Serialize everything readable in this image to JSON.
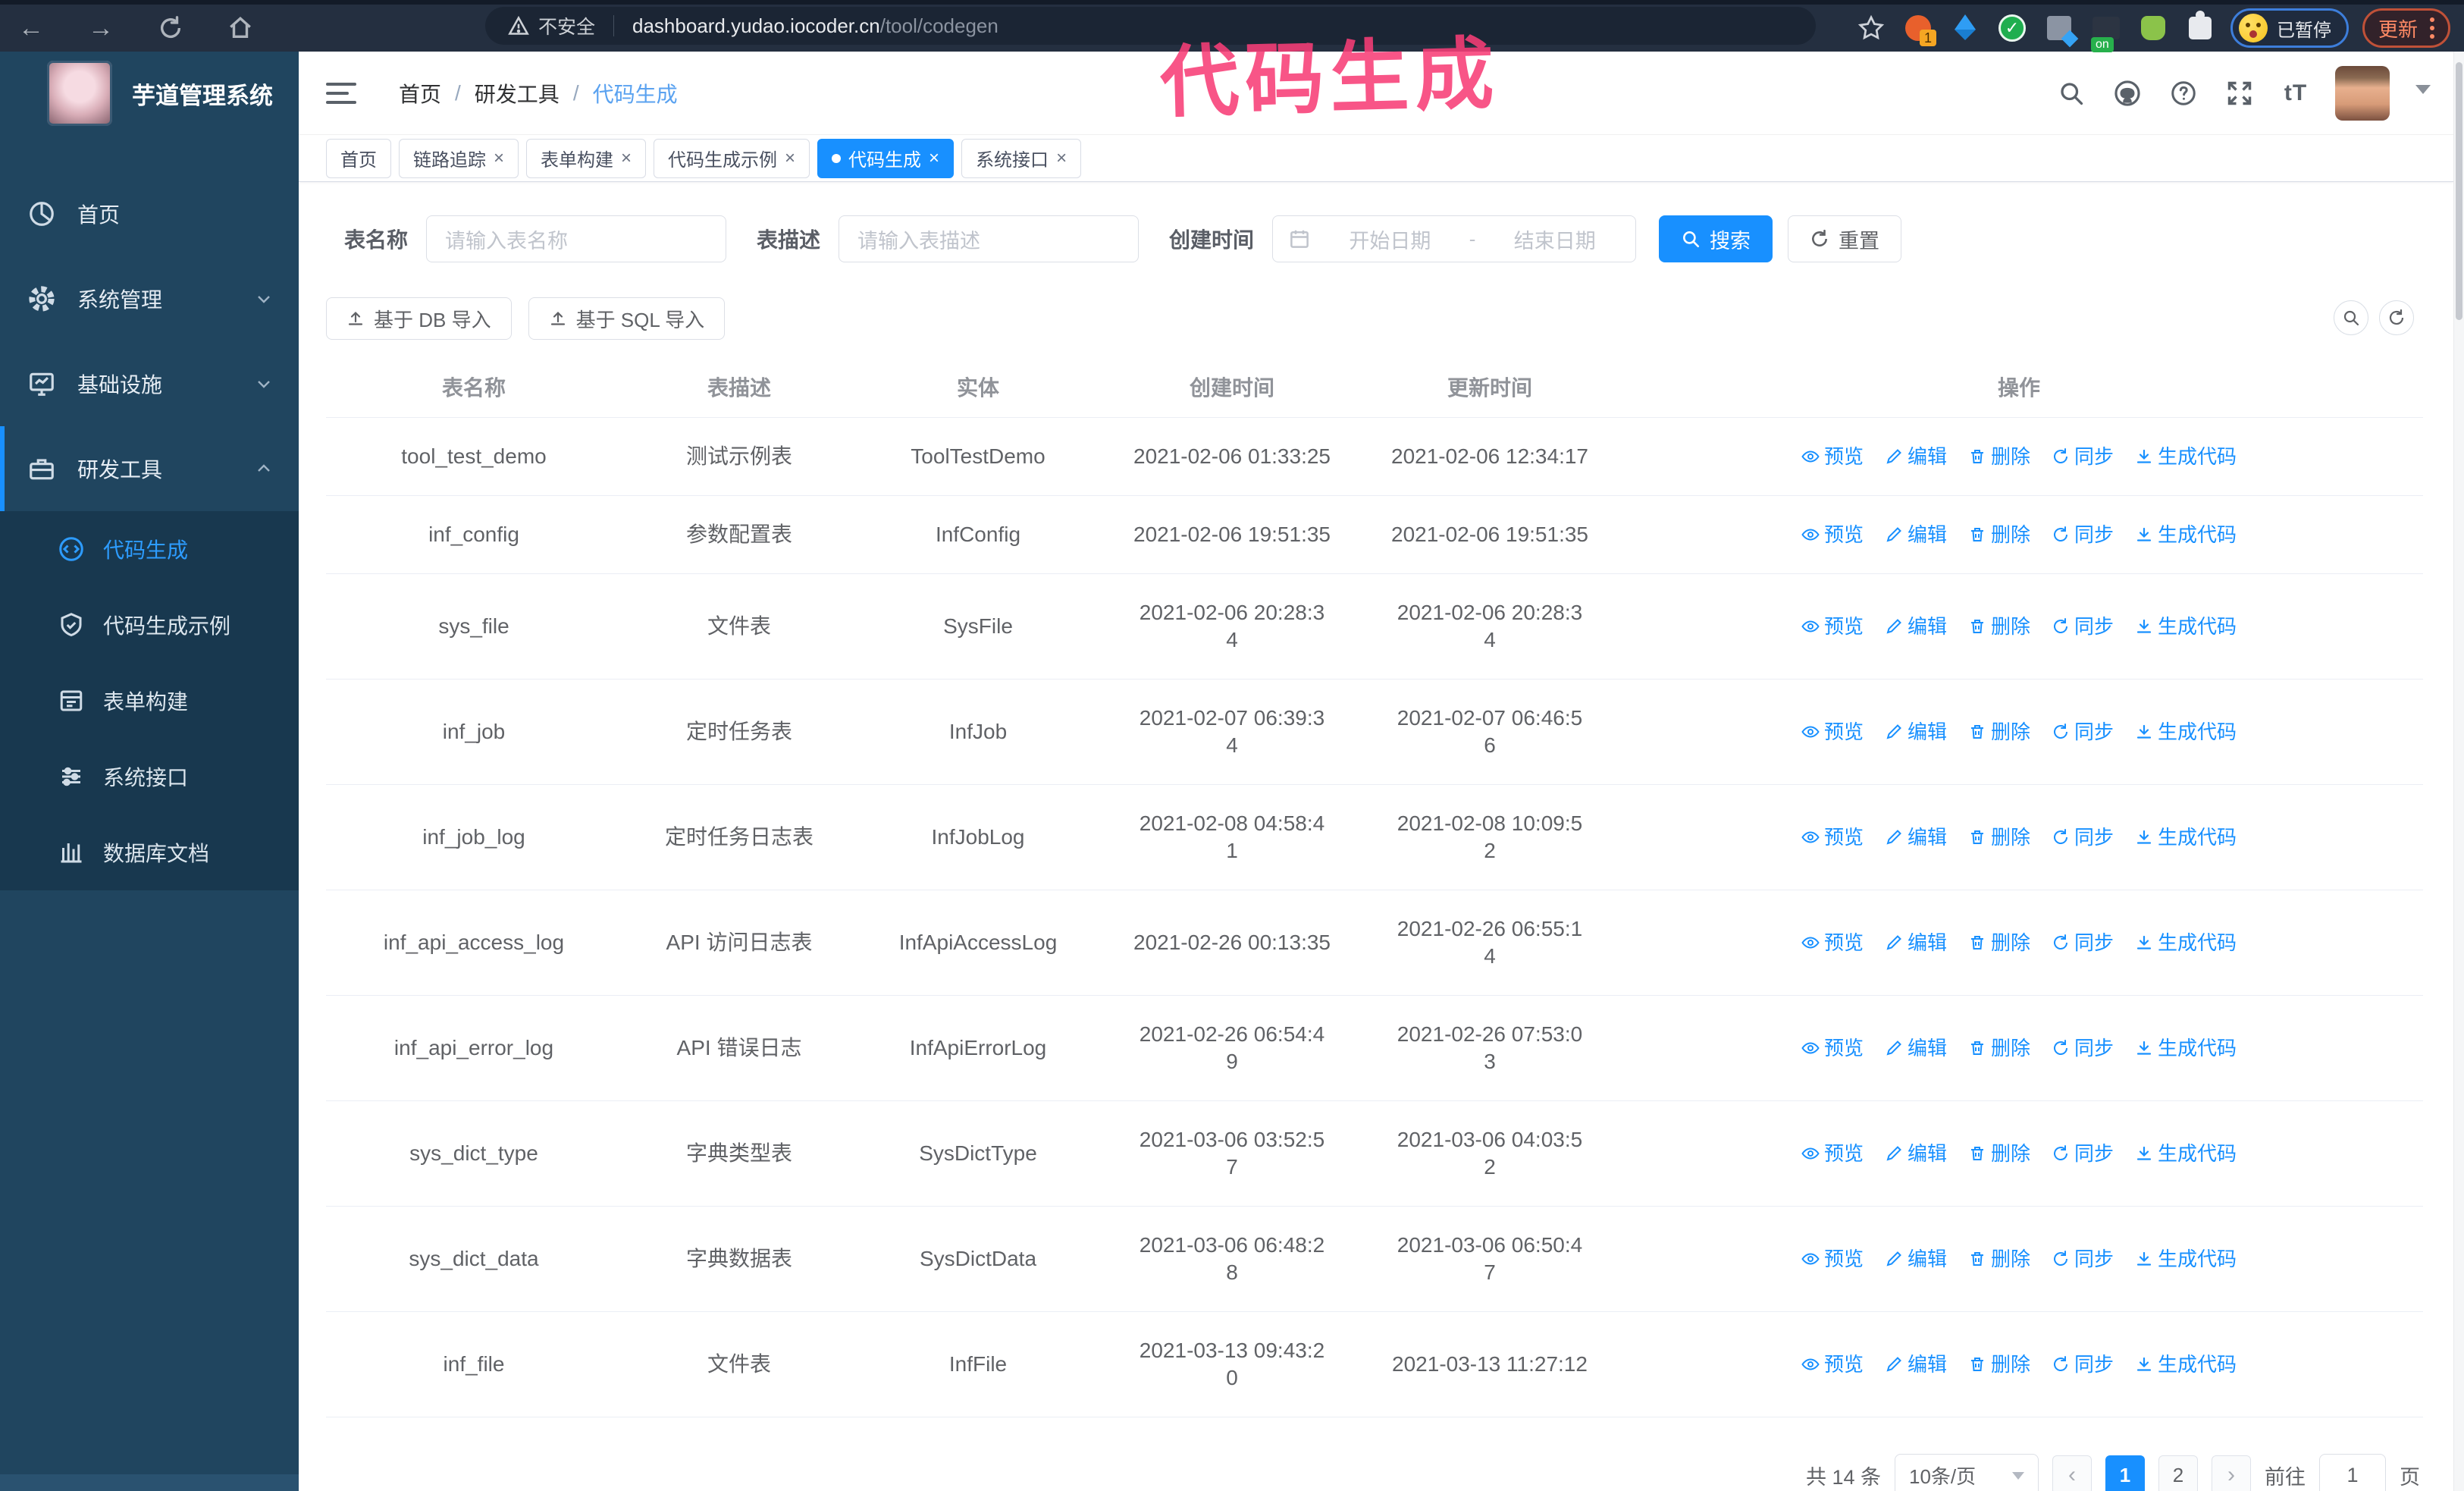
{
  "browser": {
    "security_warning": "不安全",
    "url_host": "dashboard.yudao.iocoder.cn",
    "url_path": "/tool/codegen",
    "extension_badge_count": "1",
    "extension_on_badge": "on",
    "paused_badge": "已暂停",
    "update_button": "更新"
  },
  "annotation": {
    "text": "代码生成",
    "color": "#f73e76"
  },
  "sidebar": {
    "title": "芋道管理系统",
    "items": [
      {
        "label": "首页"
      },
      {
        "label": "系统管理"
      },
      {
        "label": "基础设施"
      },
      {
        "label": "研发工具"
      }
    ],
    "submenu": [
      {
        "label": "代码生成",
        "active": true
      },
      {
        "label": "代码生成示例"
      },
      {
        "label": "表单构建"
      },
      {
        "label": "系统接口"
      },
      {
        "label": "数据库文档"
      }
    ]
  },
  "breadcrumb": {
    "items": [
      "首页",
      "研发工具",
      "代码生成"
    ],
    "separator": "/"
  },
  "tabs": [
    {
      "label": "首页"
    },
    {
      "label": "链路追踪",
      "closable": true
    },
    {
      "label": "表单构建",
      "closable": true
    },
    {
      "label": "代码生成示例",
      "closable": true
    },
    {
      "label": "代码生成",
      "closable": true,
      "active": true
    },
    {
      "label": "系统接口",
      "closable": true
    }
  ],
  "filters": {
    "name_label": "表名称",
    "name_placeholder": "请输入表名称",
    "desc_label": "表描述",
    "desc_placeholder": "请输入表描述",
    "time_label": "创建时间",
    "start_placeholder": "开始日期",
    "range_separator": "-",
    "end_placeholder": "结束日期",
    "search_label": "搜索",
    "reset_label": "重置"
  },
  "toolbar": {
    "import_db_label": "基于 DB 导入",
    "import_sql_label": "基于 SQL 导入"
  },
  "table": {
    "columns": [
      "表名称",
      "表描述",
      "实体",
      "创建时间",
      "更新时间",
      "操作"
    ],
    "actions": [
      "预览",
      "编辑",
      "删除",
      "同步",
      "生成代码"
    ],
    "rows": [
      {
        "name": "tool_test_demo",
        "desc": "测试示例表",
        "entity": "ToolTestDemo",
        "created": "2021-02-06 01:33:25",
        "updated": "2021-02-06 12:34:17"
      },
      {
        "name": "inf_config",
        "desc": "参数配置表",
        "entity": "InfConfig",
        "created": "2021-02-06 19:51:35",
        "updated": "2021-02-06 19:51:35"
      },
      {
        "name": "sys_file",
        "desc": "文件表",
        "entity": "SysFile",
        "created": "2021-02-06 20:28:34",
        "updated": "2021-02-06 20:28:34"
      },
      {
        "name": "inf_job",
        "desc": "定时任务表",
        "entity": "InfJob",
        "created": "2021-02-07 06:39:34",
        "updated": "2021-02-07 06:46:56"
      },
      {
        "name": "inf_job_log",
        "desc": "定时任务日志表",
        "entity": "InfJobLog",
        "created": "2021-02-08 04:58:41",
        "updated": "2021-02-08 10:09:52"
      },
      {
        "name": "inf_api_access_log",
        "desc": "API 访问日志表",
        "entity": "InfApiAccessLog",
        "created": "2021-02-26 00:13:35",
        "updated": "2021-02-26 06:55:14"
      },
      {
        "name": "inf_api_error_log",
        "desc": "API 错误日志",
        "entity": "InfApiErrorLog",
        "created": "2021-02-26 06:54:49",
        "updated": "2021-02-26 07:53:03"
      },
      {
        "name": "sys_dict_type",
        "desc": "字典类型表",
        "entity": "SysDictType",
        "created": "2021-03-06 03:52:57",
        "updated": "2021-03-06 04:03:52"
      },
      {
        "name": "sys_dict_data",
        "desc": "字典数据表",
        "entity": "SysDictData",
        "created": "2021-03-06 06:48:28",
        "updated": "2021-03-06 06:50:47"
      },
      {
        "name": "inf_file",
        "desc": "文件表",
        "entity": "InfFile",
        "created": "2021-03-13 09:43:20",
        "updated": "2021-03-13 11:27:12"
      }
    ]
  },
  "pagination": {
    "total_text": "共 14 条",
    "page_size": "10条/页",
    "pages": [
      {
        "num": "1",
        "active": true
      },
      {
        "num": "2"
      }
    ],
    "goto_label": "前往",
    "goto_value": "1",
    "page_suffix": "页"
  },
  "colors": {
    "accent": "#1890ff",
    "sidebar_bg": "#20455f",
    "submenu_bg": "#18384f",
    "browser_bar": "#242f40",
    "annotation": "#f73e76"
  }
}
